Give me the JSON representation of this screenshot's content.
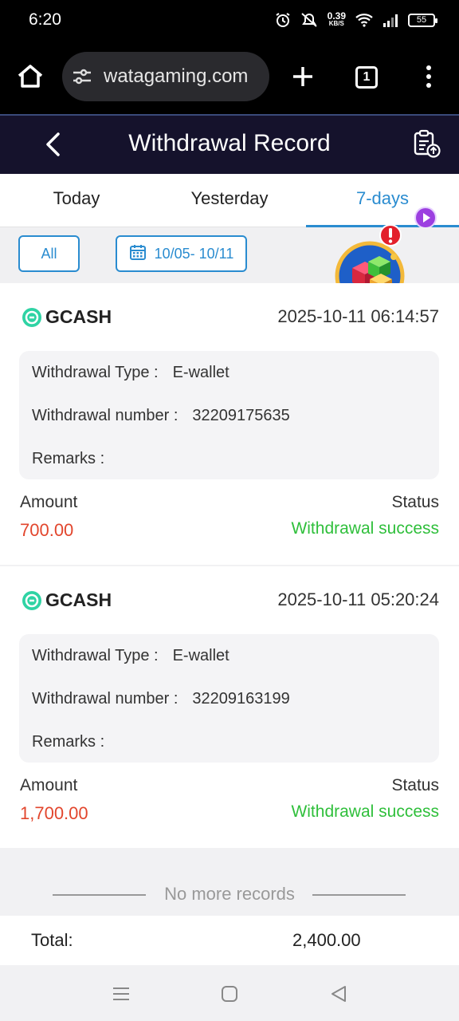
{
  "status_bar": {
    "time": "6:20",
    "net_speed_value": "0.39",
    "net_speed_unit": "KB/S",
    "battery": "55"
  },
  "browser": {
    "url": "watagaming.com",
    "tab_count": "1"
  },
  "header": {
    "title": "Withdrawal Record"
  },
  "tabs": [
    {
      "label": "Today",
      "active": false
    },
    {
      "label": "Yesterday",
      "active": false
    },
    {
      "label": "7-days",
      "active": true
    }
  ],
  "filters": {
    "all_label": "All",
    "date_range": "10/05- 10/11"
  },
  "records": [
    {
      "method": "GCASH",
      "datetime": "2025-10-11 06:14:57",
      "type_label": "Withdrawal Type :",
      "type_value": "E-wallet",
      "number_label": "Withdrawal number :",
      "number_value": "32209175635",
      "remarks_label": "Remarks :",
      "amount_label": "Amount",
      "amount_value": "700.00",
      "status_label": "Status",
      "status_value": "Withdrawal success"
    },
    {
      "method": "GCASH",
      "datetime": "2025-10-11 05:20:24",
      "type_label": "Withdrawal Type :",
      "type_value": "E-wallet",
      "number_label": "Withdrawal number :",
      "number_value": "32209163199",
      "remarks_label": "Remarks :",
      "amount_label": "Amount",
      "amount_value": "1,700.00",
      "status_label": "Status",
      "status_value": "Withdrawal success"
    }
  ],
  "footer": {
    "no_more": "No more records",
    "total_label": "Total:",
    "total_value": "2,400.00"
  },
  "colors": {
    "accent": "#2a8cd0",
    "header_bg": "#15122c",
    "amount": "#e2462d",
    "success": "#2fbf3b"
  },
  "icons": [
    "alarm-icon",
    "mute-icon",
    "wifi-icon",
    "signal-icon",
    "battery-icon",
    "home-icon",
    "tune-icon",
    "plus-icon",
    "tabs-icon",
    "more-vert-icon",
    "back-chevron-icon",
    "clipboard-upload-icon",
    "calendar-icon",
    "gcash-icon",
    "play-icon",
    "game-cube-icon",
    "alert-icon",
    "nav-menu-icon",
    "nav-home-icon",
    "nav-back-icon"
  ]
}
